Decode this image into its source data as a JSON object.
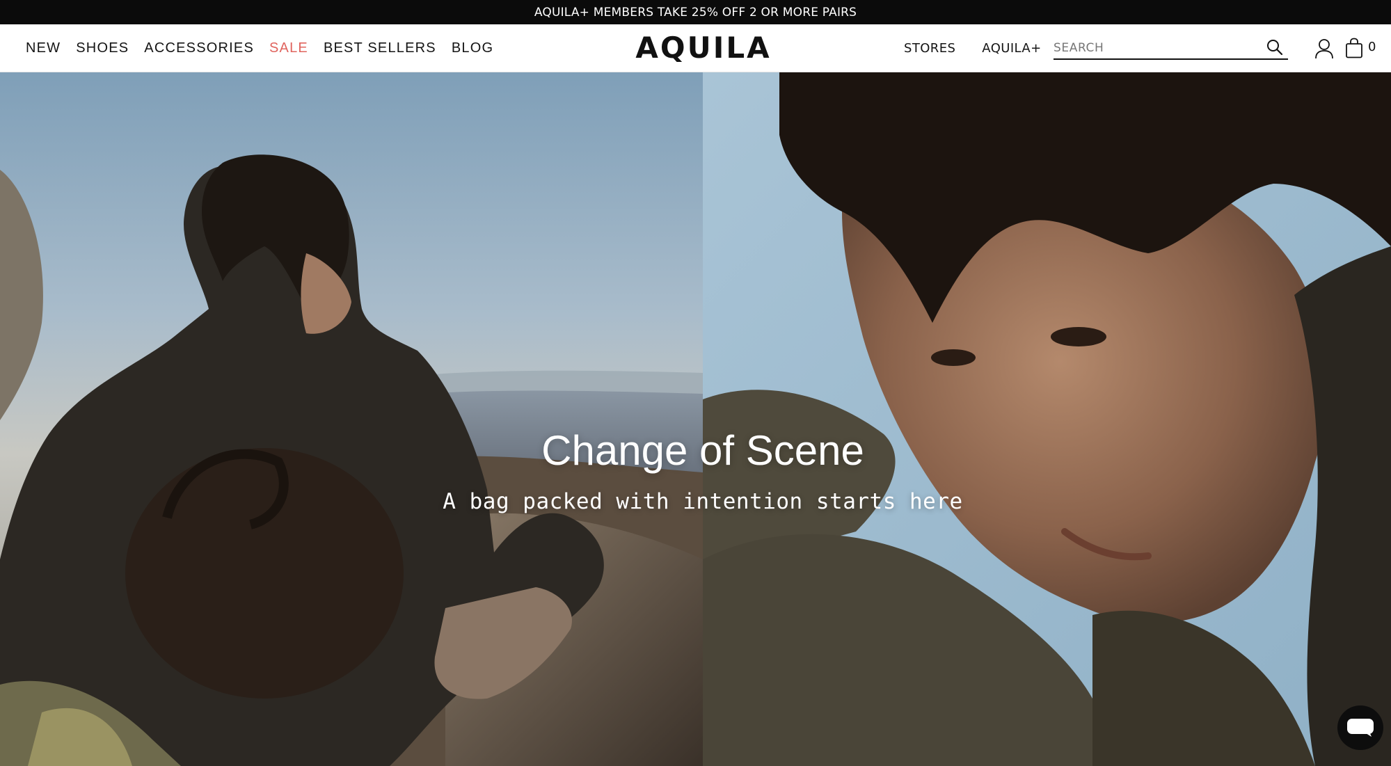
{
  "promo": {
    "text": "AQUILA+ MEMBERS TAKE 25% OFF 2 OR MORE PAIRS"
  },
  "header": {
    "nav_left": [
      {
        "label": "NEW"
      },
      {
        "label": "SHOES"
      },
      {
        "label": "ACCESSORIES"
      },
      {
        "label": "SALE",
        "color": "#e0645e"
      },
      {
        "label": "BEST SELLERS"
      },
      {
        "label": "BLOG"
      }
    ],
    "logo": "AQUILA",
    "nav_right": [
      {
        "label": "STORES"
      },
      {
        "label": "AQUILA+"
      }
    ],
    "search": {
      "placeholder": "SEARCH",
      "value": ""
    },
    "cart": {
      "count": "0"
    }
  },
  "hero": {
    "title": "Change of Scene",
    "subtitle": "A bag packed with intention starts here"
  },
  "icons": {
    "search": "search-icon",
    "account": "user-icon",
    "cart": "shopping-bag-icon",
    "chat": "chat-icon"
  },
  "colors": {
    "promo_bar": "#0b0b0b",
    "sale": "#e0645e",
    "text": "#141414"
  }
}
